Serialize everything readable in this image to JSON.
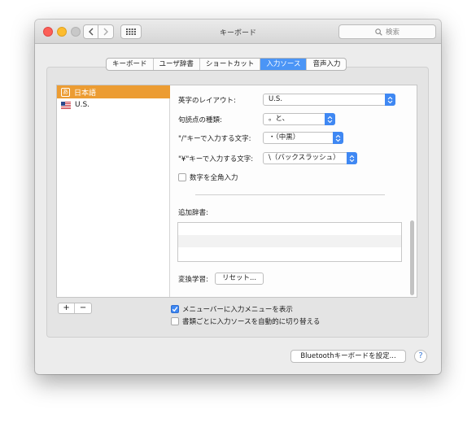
{
  "window": {
    "title": "キーボード"
  },
  "search": {
    "placeholder": "検索"
  },
  "tabs": [
    "キーボード",
    "ユーザ辞書",
    "ショートカット",
    "入力ソース",
    "音声入力"
  ],
  "selected_tab": "入力ソース",
  "sources": [
    {
      "label": "日本語",
      "icon": "japanese-input-icon",
      "selected": true
    },
    {
      "label": "U.S.",
      "icon": "us-flag-icon",
      "selected": false
    }
  ],
  "options": {
    "layout_label": "英字のレイアウト:",
    "layout_value": "U.S.",
    "punct_label": "句読点の種類:",
    "punct_value": "。と、",
    "slash_label": "\"/\"キーで入力する文字:",
    "slash_value": "・（中黒）",
    "yen_label": "\"¥\"キーで入力する文字:",
    "yen_value": "\\（バックスラッシュ）",
    "fullwidth_label": "数字を全角入力",
    "fullwidth_checked": false,
    "dict_label": "追加辞書:",
    "learning_label": "変換学習:",
    "reset_label": "リセット..."
  },
  "list_buttons": {
    "add": "+",
    "remove": "−"
  },
  "checkboxes": [
    {
      "label": "メニューバーに入力メニューを表示",
      "checked": true
    },
    {
      "label": "書類ごとに入力ソースを自動的に切り替える",
      "checked": false
    }
  ],
  "bluetooth_button": "Bluetoothキーボードを設定...",
  "help_label": "?",
  "colors": {
    "accent": "#3f88f3",
    "selection_orange": "#ec9c32",
    "tab_selected": "#4b95f6"
  }
}
